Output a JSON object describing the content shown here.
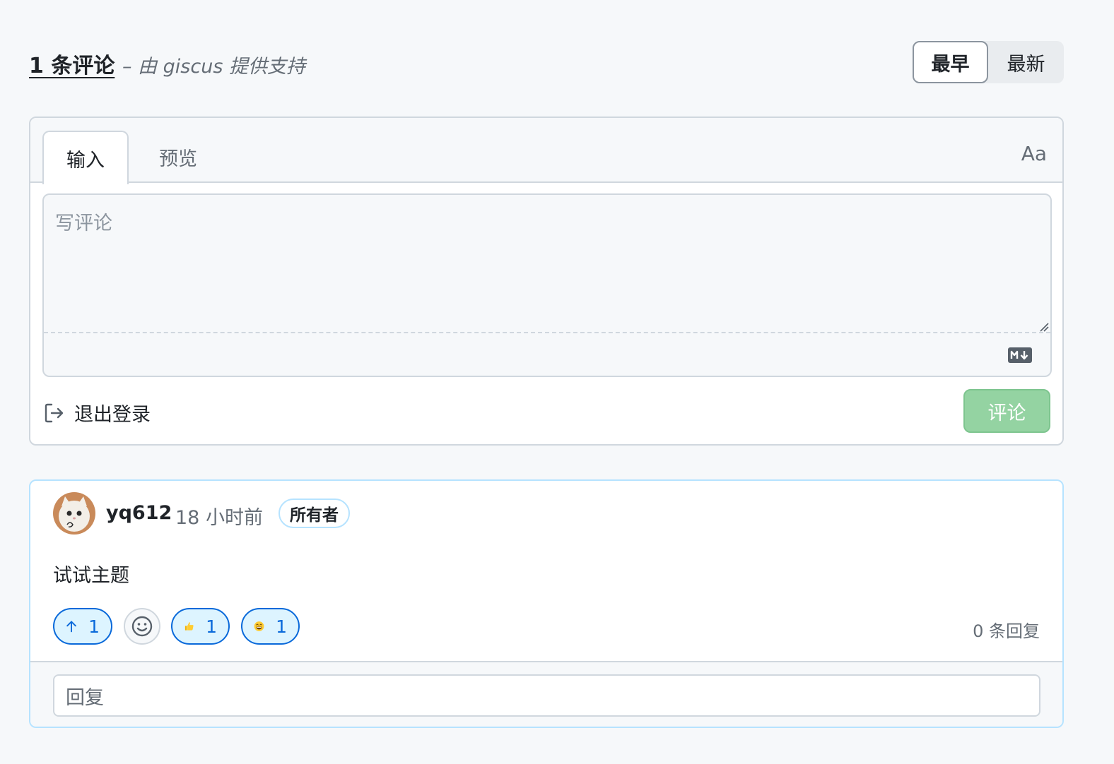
{
  "header": {
    "comment_count": "1 条评论",
    "powered_by": "– 由 giscus 提供支持",
    "sort": {
      "oldest": "最早",
      "newest": "最新",
      "active": "oldest"
    }
  },
  "editor": {
    "tabs": {
      "write": "输入",
      "preview": "预览"
    },
    "font_toggle": "Aa",
    "placeholder": "写评论",
    "signout_label": "退出登录",
    "submit_label": "评论",
    "icons": {
      "signout": "sign-out-icon",
      "markdown": "markdown-icon"
    }
  },
  "comment": {
    "author": "yq612",
    "time": "18 小时前",
    "badge": "所有者",
    "body": "试试主题",
    "reactions": [
      {
        "icon": "arrow-up-icon",
        "count": "1"
      },
      {
        "icon": "thumbs-up-icon",
        "count": "1"
      },
      {
        "icon": "grinning-face-icon",
        "count": "1"
      }
    ],
    "add_reaction_icon": "smiley-icon",
    "replies": "0 条回复",
    "reply_placeholder": "回复"
  },
  "colors": {
    "accent": "#0969da",
    "submit_disabled": "#94d3a2",
    "badge_border": "#b6e3ff",
    "background": "#f6f8fa"
  }
}
